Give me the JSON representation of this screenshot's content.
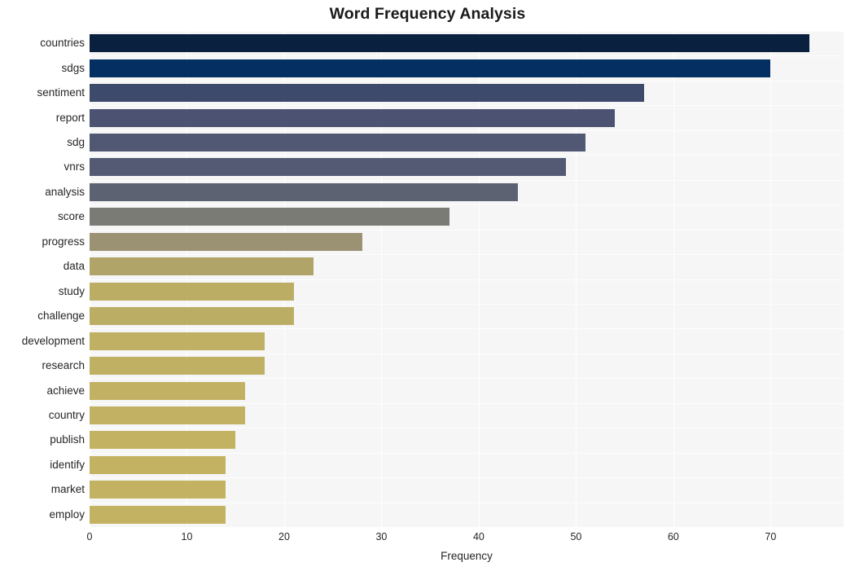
{
  "chart_data": {
    "type": "bar",
    "orientation": "horizontal",
    "title": "Word Frequency Analysis",
    "xlabel": "Frequency",
    "ylabel": "",
    "xlim": [
      0,
      77.5
    ],
    "ylim": [
      0,
      20
    ],
    "grid": true,
    "legend": false,
    "xticks": [
      0,
      10,
      20,
      30,
      40,
      50,
      60,
      70
    ],
    "xticklabels": [
      "0",
      "10",
      "20",
      "30",
      "40",
      "50",
      "60",
      "70"
    ],
    "categories": [
      "countries",
      "sdgs",
      "sentiment",
      "report",
      "sdg",
      "vnrs",
      "analysis",
      "score",
      "progress",
      "data",
      "study",
      "challenge",
      "development",
      "research",
      "achieve",
      "country",
      "publish",
      "identify",
      "market",
      "employ"
    ],
    "values": [
      74,
      70,
      57,
      54,
      51,
      49,
      44,
      37,
      28,
      23,
      21,
      21,
      18,
      18,
      16,
      16,
      15,
      14,
      14,
      14
    ],
    "bar_colors": [
      "#09203f",
      "#032f63",
      "#3e4a6b",
      "#4c5372",
      "#515873",
      "#545a74",
      "#5c6272",
      "#7b7b76",
      "#9a9273",
      "#b0a469",
      "#bcad64",
      "#bcad64",
      "#c0b063",
      "#c0b063",
      "#c2b162",
      "#c2b162",
      "#c3b261",
      "#c3b261",
      "#c3b261",
      "#c3b261"
    ],
    "plot_background": "#f6f6f6",
    "figure_background": "#ffffff",
    "gridline_color": "#ffffff",
    "text_color": "#262626"
  }
}
